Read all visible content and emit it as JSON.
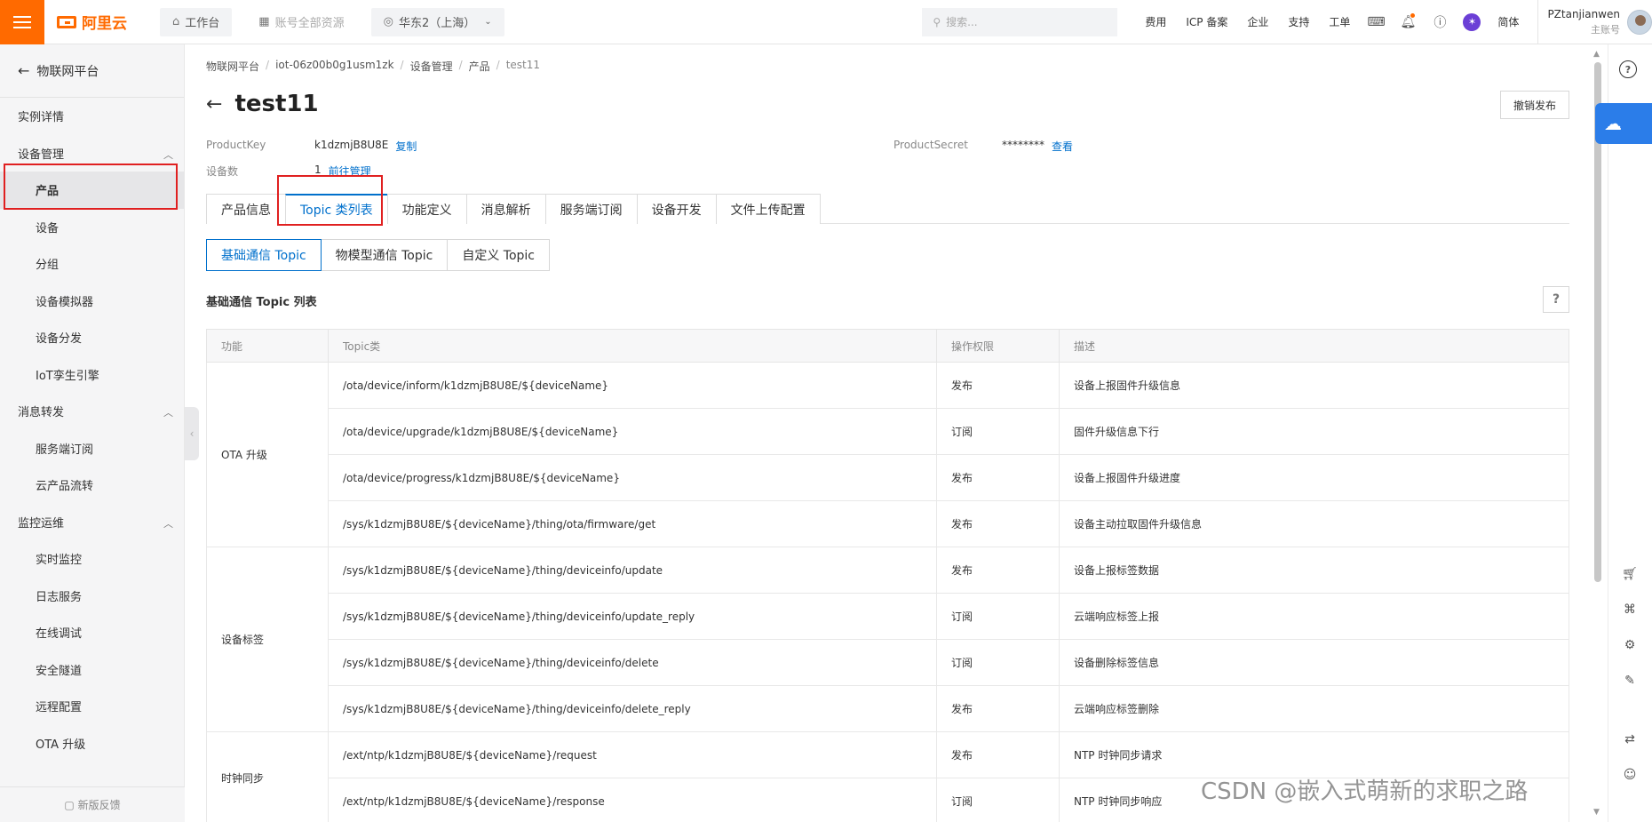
{
  "topbar": {
    "brand": "阿里云",
    "workbench": "工作台",
    "account_scope": "账号全部资源",
    "region": "华东2（上海）",
    "search_placeholder": "搜索...",
    "links": [
      "费用",
      "ICP 备案",
      "企业",
      "支持",
      "工单"
    ],
    "lang": "简体",
    "username": "PZtanjianwen",
    "role": "主账号"
  },
  "sidebar": {
    "back_label": "物联网平台",
    "items": [
      {
        "label": "实例详情",
        "level": "top"
      },
      {
        "label": "设备管理",
        "level": "group"
      },
      {
        "label": "产品",
        "level": "sub",
        "active": true
      },
      {
        "label": "设备",
        "level": "sub"
      },
      {
        "label": "分组",
        "level": "sub"
      },
      {
        "label": "设备模拟器",
        "level": "sub"
      },
      {
        "label": "设备分发",
        "level": "sub"
      },
      {
        "label": "IoT孪生引擎",
        "level": "sub"
      },
      {
        "label": "消息转发",
        "level": "group"
      },
      {
        "label": "服务端订阅",
        "level": "sub"
      },
      {
        "label": "云产品流转",
        "level": "sub"
      },
      {
        "label": "监控运维",
        "level": "group"
      },
      {
        "label": "实时监控",
        "level": "sub"
      },
      {
        "label": "日志服务",
        "level": "sub"
      },
      {
        "label": "在线调试",
        "level": "sub"
      },
      {
        "label": "安全隧道",
        "level": "sub"
      },
      {
        "label": "远程配置",
        "level": "sub"
      },
      {
        "label": "OTA 升级",
        "level": "sub"
      }
    ],
    "feedback": "新版反馈"
  },
  "breadcrumb": [
    "物联网平台",
    "iot-06z00b0g1usm1zk",
    "设备管理",
    "产品",
    "test11"
  ],
  "page": {
    "title": "test11",
    "revoke_button": "撤销发布",
    "product_key_label": "ProductKey",
    "product_key": "k1dzmjB8U8E",
    "copy_label": "复制",
    "product_secret_label": "ProductSecret",
    "product_secret": "********",
    "view_label": "查看",
    "device_count_label": "设备数",
    "device_count": "1",
    "manage_label": "前往管理"
  },
  "tabs": [
    "产品信息",
    "Topic 类列表",
    "功能定义",
    "消息解析",
    "服务端订阅",
    "设备开发",
    "文件上传配置"
  ],
  "subtabs": [
    "基础通信 Topic",
    "物模型通信 Topic",
    "自定义 Topic"
  ],
  "section_title": "基础通信 Topic 列表",
  "table": {
    "headers": [
      "功能",
      "Topic类",
      "操作权限",
      "描述"
    ],
    "groups": [
      {
        "func": "OTA 升级",
        "rows": [
          {
            "topic": "/ota/device/inform/k1dzmjB8U8E/${deviceName}",
            "perm": "发布",
            "desc": "设备上报固件升级信息"
          },
          {
            "topic": "/ota/device/upgrade/k1dzmjB8U8E/${deviceName}",
            "perm": "订阅",
            "desc": "固件升级信息下行"
          },
          {
            "topic": "/ota/device/progress/k1dzmjB8U8E/${deviceName}",
            "perm": "发布",
            "desc": "设备上报固件升级进度"
          },
          {
            "topic": "/sys/k1dzmjB8U8E/${deviceName}/thing/ota/firmware/get",
            "perm": "发布",
            "desc": "设备主动拉取固件升级信息"
          }
        ]
      },
      {
        "func": "设备标签",
        "rows": [
          {
            "topic": "/sys/k1dzmjB8U8E/${deviceName}/thing/deviceinfo/update",
            "perm": "发布",
            "desc": "设备上报标签数据"
          },
          {
            "topic": "/sys/k1dzmjB8U8E/${deviceName}/thing/deviceinfo/update_reply",
            "perm": "订阅",
            "desc": "云端响应标签上报"
          },
          {
            "topic": "/sys/k1dzmjB8U8E/${deviceName}/thing/deviceinfo/delete",
            "perm": "订阅",
            "desc": "设备删除标签信息"
          },
          {
            "topic": "/sys/k1dzmjB8U8E/${deviceName}/thing/deviceinfo/delete_reply",
            "perm": "发布",
            "desc": "云端响应标签删除"
          }
        ]
      },
      {
        "func": "时钟同步",
        "rows": [
          {
            "topic": "/ext/ntp/k1dzmjB8U8E/${deviceName}/request",
            "perm": "发布",
            "desc": "NTP 时钟同步请求"
          },
          {
            "topic": "/ext/ntp/k1dzmjB8U8E/${deviceName}/response",
            "perm": "订阅",
            "desc": "NTP 时钟同步响应"
          }
        ]
      }
    ]
  },
  "watermark": "CSDN @嵌入式萌新的求职之路"
}
